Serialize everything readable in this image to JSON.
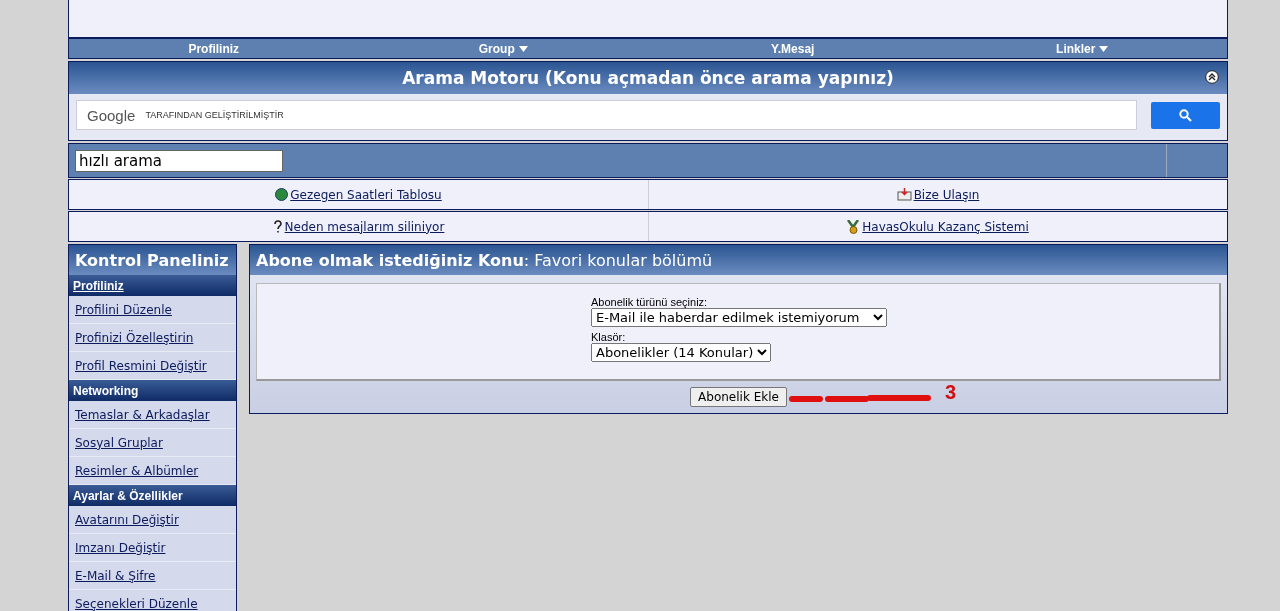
{
  "nav": [
    {
      "label": "Profiliniz",
      "dropdown": false
    },
    {
      "label": "Group",
      "dropdown": true
    },
    {
      "label": "Y.Mesaj",
      "dropdown": false
    },
    {
      "label": "Linkler",
      "dropdown": true
    }
  ],
  "search_panel": {
    "title": "Arama Motoru (Konu açmadan önce arama yapınız)",
    "collapsed": false,
    "brand": "Google",
    "branding_note": "TARAFINDAN GELİŞTİRİLMİŞTİR"
  },
  "quick_search": {
    "value": "hızlı arama"
  },
  "links": [
    {
      "label": "Gezegen Saatleri Tablosu",
      "kind": "globe"
    },
    {
      "label": "Bize Ulaşın",
      "kind": "mail"
    },
    {
      "label": "Neden mesajlarım siliniyor",
      "kind": "question"
    },
    {
      "label": "HavasOkulu Kazanç Sistemi",
      "kind": "medal"
    }
  ],
  "sidebar": {
    "title": "Kontrol Paneliniz",
    "items": [
      {
        "kind": "section",
        "label": "Profiliniz",
        "link": true
      },
      {
        "kind": "item",
        "label": "Profilini Düzenle"
      },
      {
        "kind": "item",
        "label": "Profinizi Özelleştirin"
      },
      {
        "kind": "item",
        "label": "Profil Resmini Değiştir"
      },
      {
        "kind": "section",
        "label": "Networking",
        "link": false
      },
      {
        "kind": "item",
        "label": "Temaslar & Arkadaşlar"
      },
      {
        "kind": "item",
        "label": "Sosyal Gruplar"
      },
      {
        "kind": "item",
        "label": "Resimler & Albümler"
      },
      {
        "kind": "section",
        "label": "Ayarlar & Özellikler",
        "link": false
      },
      {
        "kind": "item",
        "label": "Avatarını Değiştir"
      },
      {
        "kind": "item",
        "label": "Imzanı Değiştir"
      },
      {
        "kind": "item",
        "label": "E-Mail & Şifre"
      },
      {
        "kind": "item",
        "label": "Seçenekleri Düzenle"
      }
    ]
  },
  "content": {
    "title": "**Abone olmak istediğiniz Konu**: Favori konular bölümü",
    "fields": [
      {
        "label": "Abonelik türünü seçiniz:",
        "value": "E-Mail ile haberdar edilmek istemiyorum",
        "wide": true
      },
      {
        "label": "Klasör:",
        "value": "Abonelikler (14 Konular)",
        "wide": false
      }
    ],
    "button": "Abonelik Ekle",
    "annotation": "3"
  }
}
